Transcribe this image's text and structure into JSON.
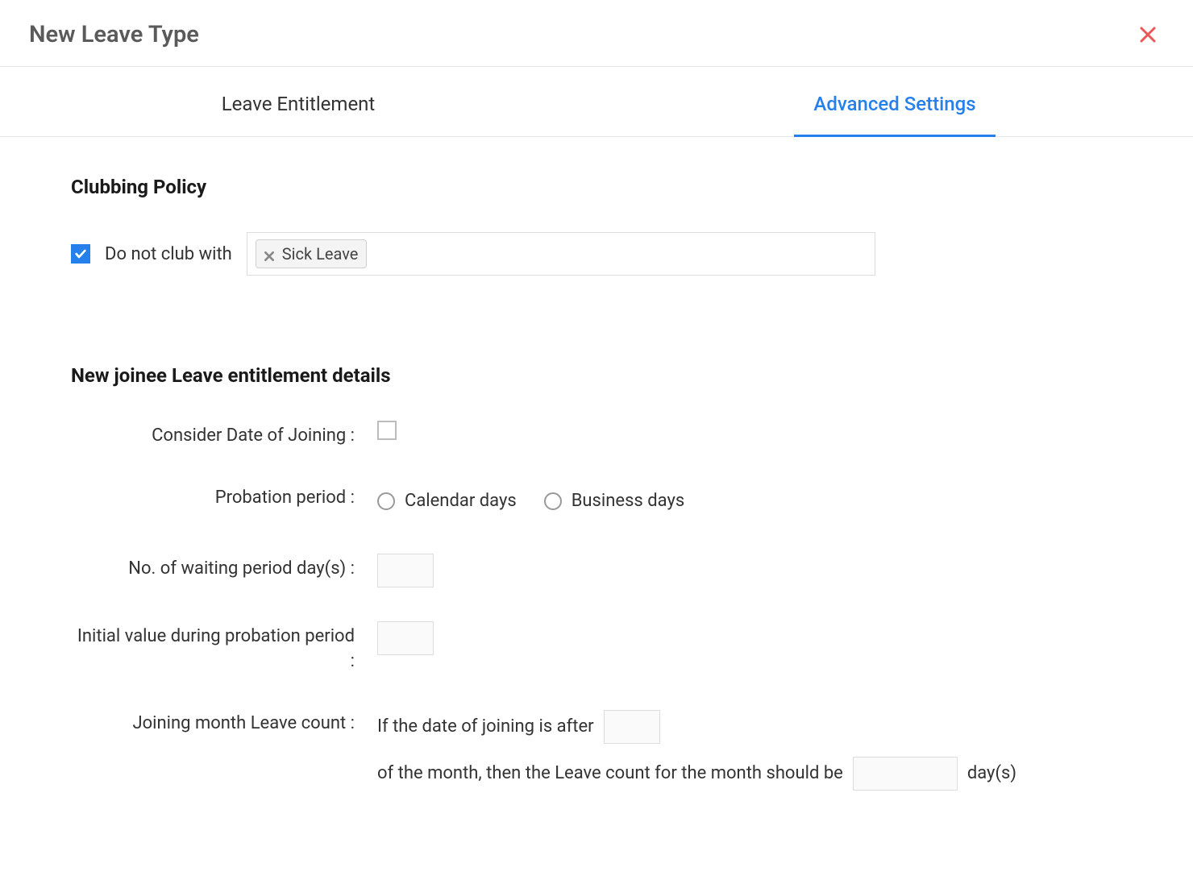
{
  "header": {
    "title": "New Leave Type"
  },
  "tabs": {
    "entitlement": "Leave Entitlement",
    "advanced": "Advanced Settings"
  },
  "clubbing": {
    "title": "Clubbing Policy",
    "checkbox_label": "Do not club with",
    "tag_value": "Sick Leave"
  },
  "joinee": {
    "title": "New joinee Leave entitlement details",
    "consider_doj_label": "Consider Date of Joining :",
    "probation_label": "Probation period :",
    "probation_option_calendar": "Calendar days",
    "probation_option_business": "Business days",
    "waiting_days_label": "No. of waiting period day(s) :",
    "waiting_days_value": "",
    "initial_value_label": "Initial value during probation period :",
    "initial_value_value": "",
    "joining_count_label": "Joining month Leave count :",
    "joining_text_1": "If the date of joining is after",
    "joining_date_value": "",
    "joining_text_2": "of the month, then the Leave count for the month should be",
    "joining_days_value": "",
    "joining_text_3": "day(s)"
  }
}
